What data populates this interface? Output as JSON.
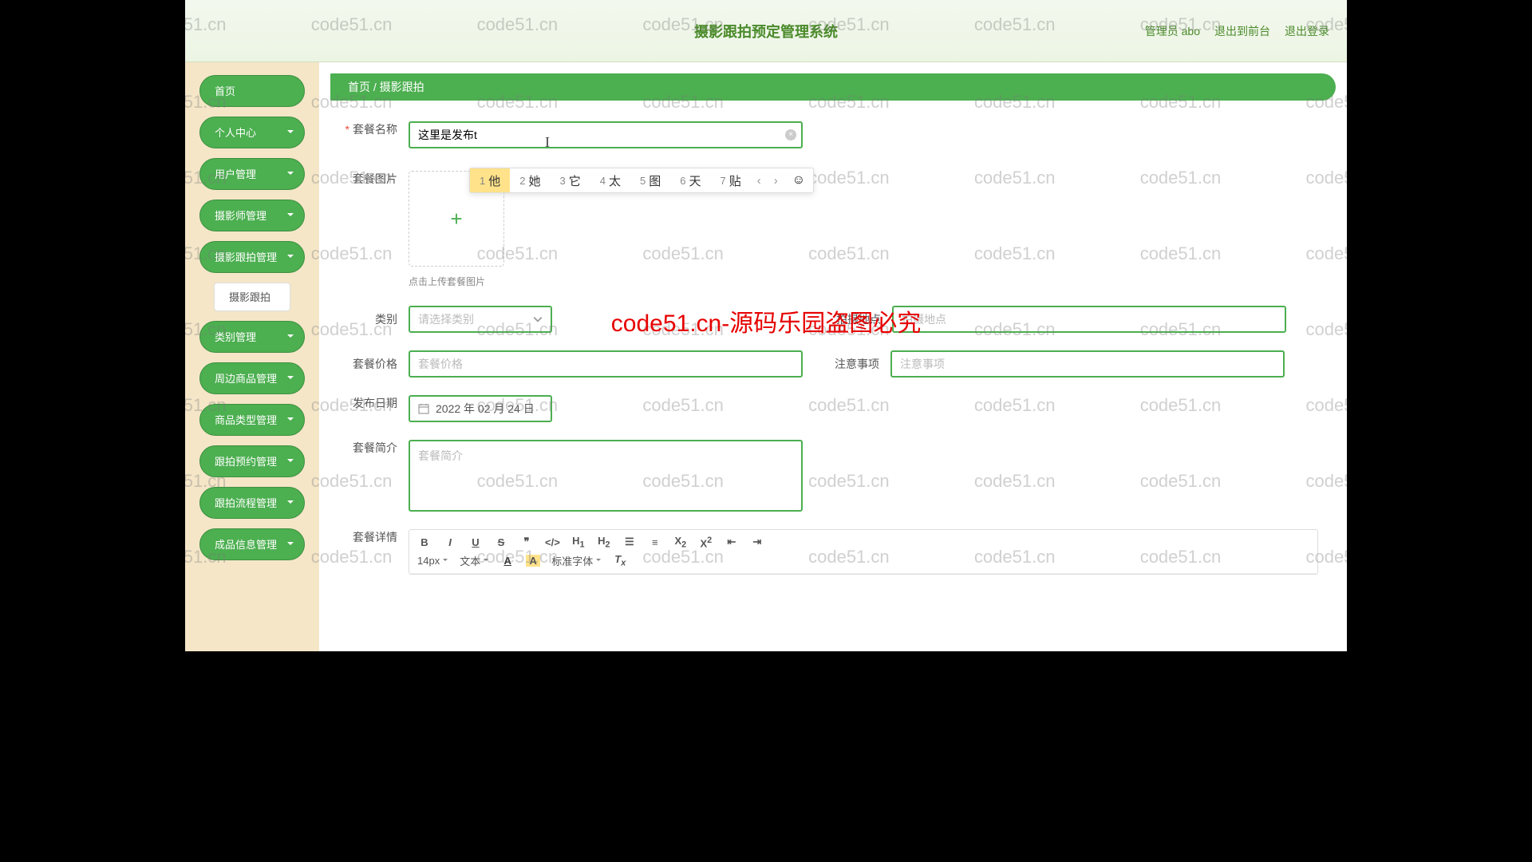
{
  "header": {
    "title": "摄影跟拍预定管理系统",
    "admin": "管理员 abo",
    "exit_front": "退出到前台",
    "logout": "退出登录"
  },
  "sidebar": {
    "items": [
      {
        "label": "首页",
        "chev": false
      },
      {
        "label": "个人中心",
        "chev": true
      },
      {
        "label": "用户管理",
        "chev": true
      },
      {
        "label": "摄影师管理",
        "chev": true
      },
      {
        "label": "摄影跟拍管理",
        "chev": true
      },
      {
        "label": "摄影跟拍",
        "sub": true
      },
      {
        "label": "类别管理",
        "chev": true
      },
      {
        "label": "周边商品管理",
        "chev": true
      },
      {
        "label": "商品类型管理",
        "chev": true
      },
      {
        "label": "跟拍预约管理",
        "chev": true
      },
      {
        "label": "跟拍流程管理",
        "chev": true
      },
      {
        "label": "成品信息管理",
        "chev": true
      }
    ]
  },
  "breadcrumb": {
    "home": "首页",
    "sep": "/",
    "current": "摄影跟拍"
  },
  "form": {
    "name_label": "套餐名称",
    "name_value": "这里是发布t",
    "image_label": "套餐图片",
    "image_hint": "点击上传套餐图片",
    "category_label": "类别",
    "category_placeholder": "请选择类别",
    "location_label": "拍摄地点",
    "location_placeholder": "拍摄地点",
    "price_label": "套餐价格",
    "price_placeholder": "套餐价格",
    "notice_label": "注意事项",
    "notice_placeholder": "注意事项",
    "date_label": "发布日期",
    "date_value": "2022 年 02 月 24 日",
    "intro_label": "套餐简介",
    "intro_placeholder": "套餐简介",
    "detail_label": "套餐详情"
  },
  "ime": {
    "candidates": [
      {
        "n": "1",
        "c": "他"
      },
      {
        "n": "2",
        "c": "她"
      },
      {
        "n": "3",
        "c": "它"
      },
      {
        "n": "4",
        "c": "太"
      },
      {
        "n": "5",
        "c": "图"
      },
      {
        "n": "6",
        "c": "天"
      },
      {
        "n": "7",
        "c": "贴"
      }
    ]
  },
  "editor": {
    "b": "B",
    "i": "I",
    "u": "U",
    "s": "S",
    "quote": "❝",
    "code": "</>",
    "h1": "H₁",
    "h2": "H₂",
    "fontsize": "14px",
    "fontstyle": "文本",
    "fontfamily": "标准字体"
  },
  "watermark": {
    "text": "code51.cn",
    "center": "code51.cn-源码乐园盗图必究"
  }
}
